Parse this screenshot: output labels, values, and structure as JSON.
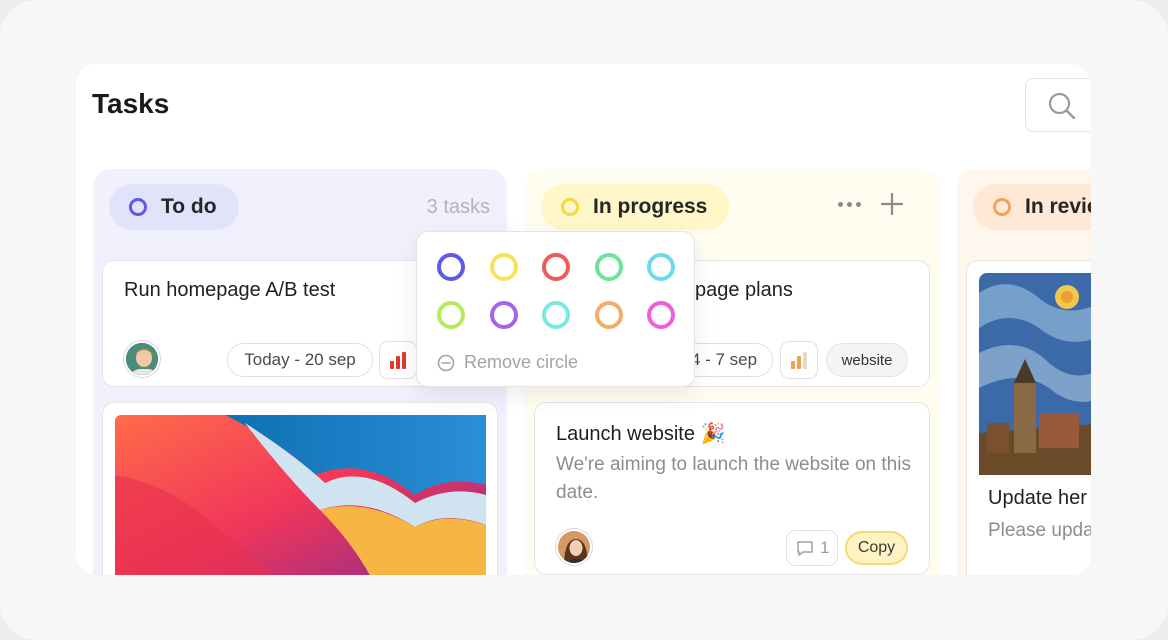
{
  "page": {
    "title": "Tasks"
  },
  "columns": {
    "todo": {
      "label": "To do",
      "count": "3 tasks",
      "ring_color": "#5b5be8"
    },
    "progress": {
      "label": "In progress",
      "ring_color": "#f2dc3c"
    },
    "review": {
      "label": "In revie",
      "ring_color": "#f0a35a"
    }
  },
  "cards": {
    "ab_test": {
      "title": "Run homepage A/B test",
      "date": "Today - 20 sep",
      "priority_color": "#e0392c"
    },
    "page_plans": {
      "title": "page plans",
      "date": "4 - 7 sep",
      "tag": "website",
      "priority_color": "#f2a04a"
    },
    "launch": {
      "title": "Launch website 🎉",
      "desc": "We're aiming to launch the website on this date.",
      "comments": "1",
      "tag": "Copy"
    },
    "update": {
      "title": "Update her",
      "desc": "Please upda"
    }
  },
  "popover": {
    "swatches": [
      "#5b5be8",
      "#f7e25b",
      "#ee5a5a",
      "#6ee49a",
      "#6fd8ef",
      "#b6ea5c",
      "#a563ec",
      "#7ce9e0",
      "#f3ad66",
      "#ef5fd9"
    ],
    "remove_label": "Remove circle"
  },
  "icons": {
    "search": "search-icon",
    "more": "more-horizontal-icon",
    "add": "plus-icon",
    "priority": "bar-chart-icon",
    "comment": "comment-icon",
    "remove": "minus-circle-icon"
  }
}
